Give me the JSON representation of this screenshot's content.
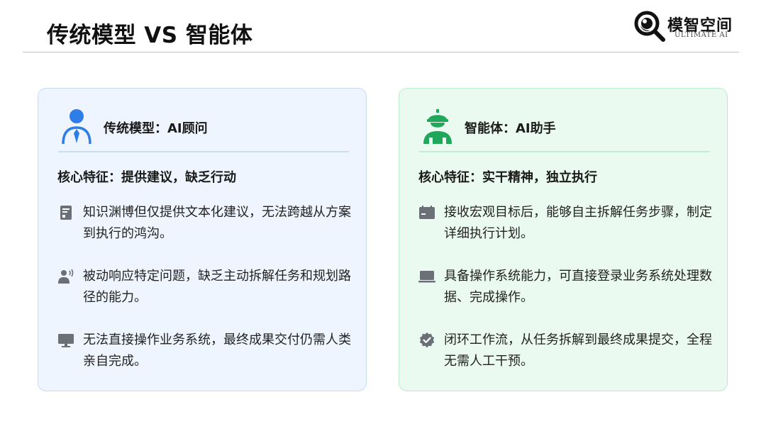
{
  "header": {
    "title": "传统模型 VS 智能体",
    "logo": {
      "cn": "模智空间",
      "en": "ULTIMATE AI",
      "icon": "magnifier-logo-icon"
    }
  },
  "left_card": {
    "title": "传统模型：AI顾问",
    "head_icon": "advisor-person-icon",
    "core": "核心特征：提供建议，缺乏行动",
    "accent": "#2f7ee8",
    "items": [
      {
        "icon": "document-icon",
        "text": "知识渊博但仅提供文本化建议，无法跨越从方案到执行的鸿沟。"
      },
      {
        "icon": "speaking-person-icon",
        "text": "被动响应特定问题，缺乏主动拆解任务和规划路径的能力。"
      },
      {
        "icon": "monitor-icon",
        "text": "无法直接操作业务系统，最终成果交付仍需人类亲自完成。"
      }
    ]
  },
  "right_card": {
    "title": "智能体：AI助手",
    "head_icon": "worker-helmet-icon",
    "core": "核心特征：实干精神，独立执行",
    "accent": "#1fa85a",
    "items": [
      {
        "icon": "calendar-board-icon",
        "text": "接收宏观目标后，能够自主拆解任务步骤，制定详细执行计划。"
      },
      {
        "icon": "laptop-icon",
        "text": "具备操作系统能力，可直接登录业务系统处理数据、完成操作。"
      },
      {
        "icon": "verified-badge-icon",
        "text": "闭环工作流，从任务拆解到最终成果提交，全程无需人工干预。"
      }
    ]
  }
}
